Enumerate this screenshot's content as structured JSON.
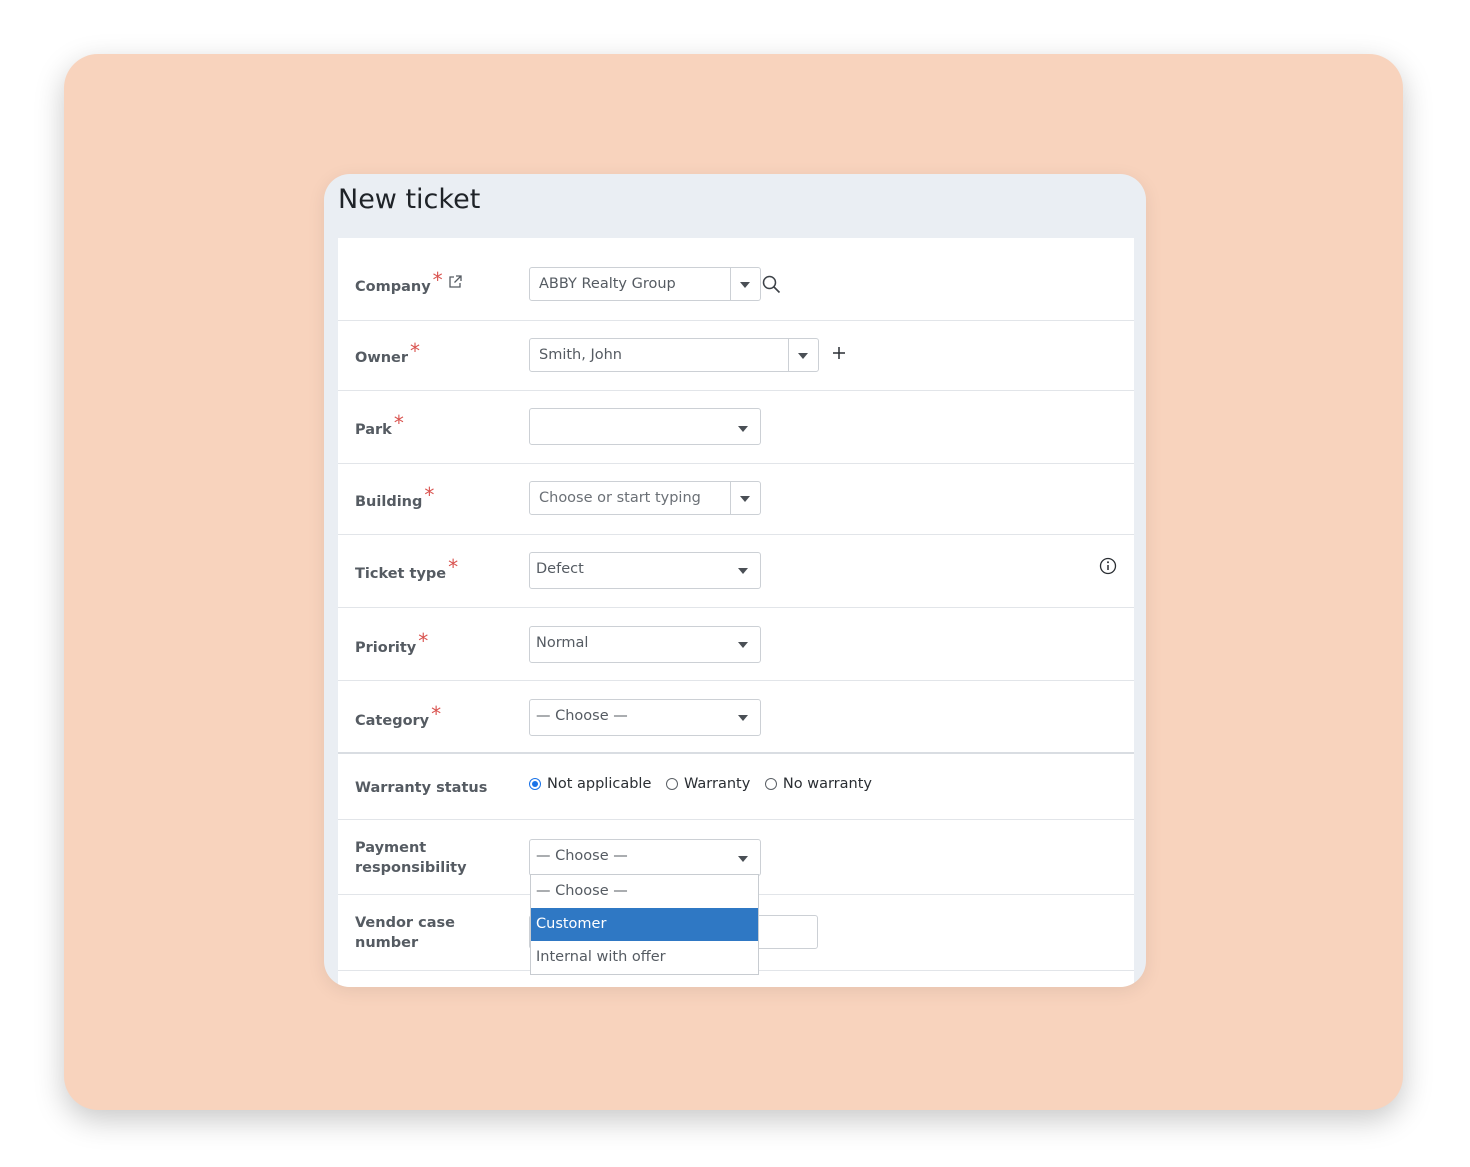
{
  "form": {
    "title": "New ticket",
    "company": {
      "label": "Company",
      "value": "ABBY Realty Group"
    },
    "owner": {
      "label": "Owner",
      "value": "Smith, John"
    },
    "park": {
      "label": "Park",
      "value": ""
    },
    "building": {
      "label": "Building",
      "placeholder": "Choose or start typing"
    },
    "ticket_type": {
      "label": "Ticket type",
      "value": "Defect"
    },
    "priority": {
      "label": "Priority",
      "value": "Normal"
    },
    "category": {
      "label": "Category",
      "value": "— Choose —"
    },
    "warranty": {
      "label": "Warranty status",
      "options": [
        "Not applicable",
        "Warranty",
        "No warranty"
      ],
      "selected": "Not applicable"
    },
    "payment": {
      "label_line1": "Payment",
      "label_line2": "responsibility",
      "value": "— Choose —",
      "options": [
        "— Choose —",
        "Customer",
        "Internal with offer"
      ],
      "highlighted": "Customer"
    },
    "vendor_case": {
      "label_line1": "Vendor case",
      "label_line2": "number",
      "value": ""
    },
    "required_mark": "*"
  },
  "colors": {
    "backdrop": "#f8d3bd",
    "header": "#eaeef3",
    "required": "#d9534f",
    "highlight": "#2f78c4",
    "radio_accent": "#1a73e8"
  },
  "icons": {
    "company": "external-link-icon",
    "company_search": "search-icon",
    "owner_add": "plus-icon",
    "ticket_type_info": "info-icon"
  }
}
